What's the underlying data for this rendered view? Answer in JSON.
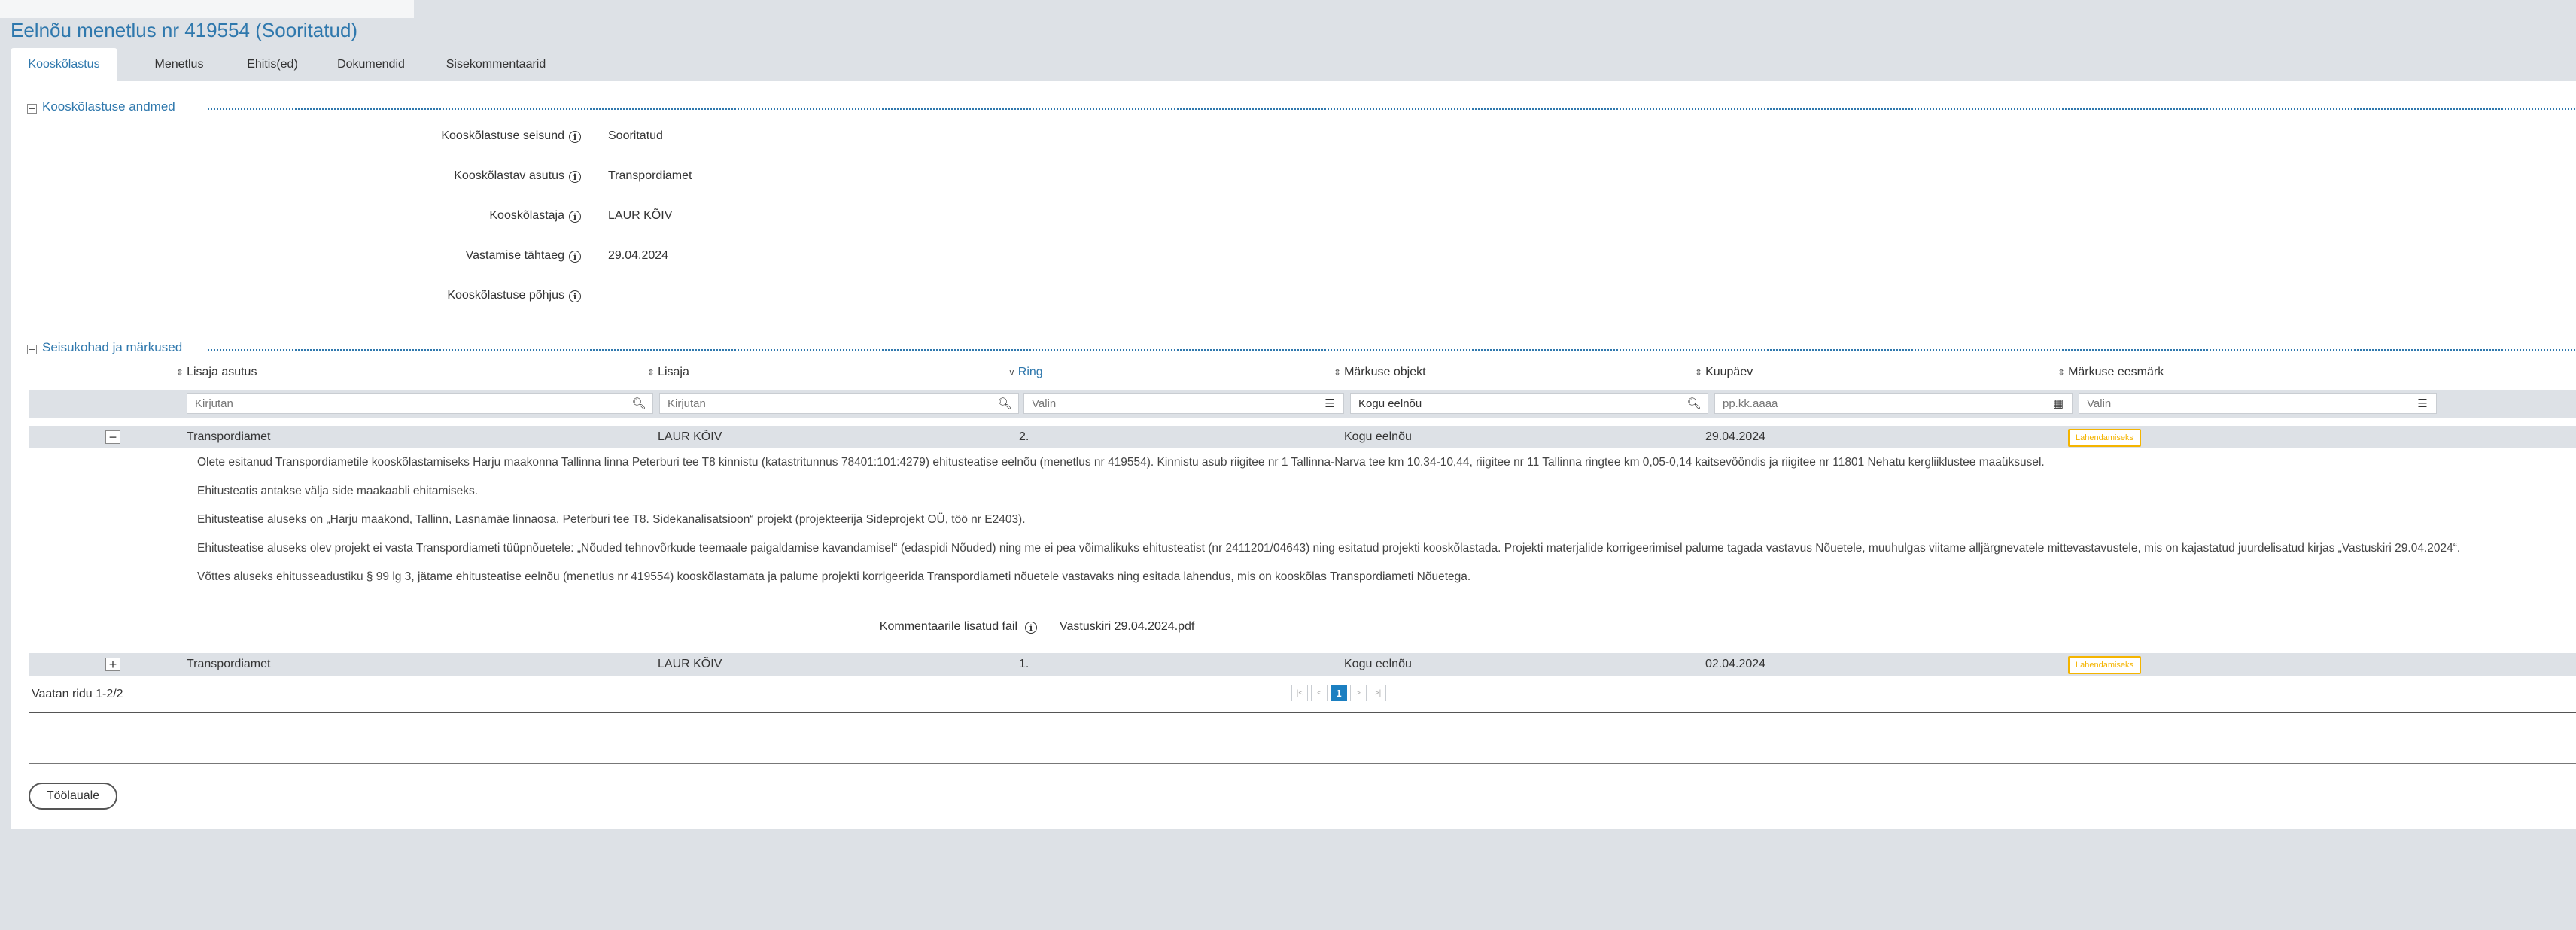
{
  "page": {
    "title": "Eelnõu menetlus nr 419554 (Sooritatud)"
  },
  "tabs": [
    {
      "label": "Kooskõlastus",
      "active": true
    },
    {
      "label": "Menetlus"
    },
    {
      "label": "Ehitis(ed)"
    },
    {
      "label": "Dokumendid"
    },
    {
      "label": "Sisekommentaarid"
    }
  ],
  "section1": {
    "title": "Kooskõlastuse andmed",
    "fields": [
      {
        "label": "Kooskõlastuse seisund",
        "value": "Sooritatud"
      },
      {
        "label": "Kooskõlastav asutus",
        "value": "Transpordiamet"
      },
      {
        "label": "Kooskõlastaja",
        "value": "LAUR KÕIV"
      },
      {
        "label": "Vastamise tähtaeg",
        "value": "29.04.2024"
      },
      {
        "label": "Kooskõlastuse põhjus",
        "value": ""
      }
    ]
  },
  "section2": {
    "title": "Seisukohad ja märkused",
    "columns": [
      {
        "label": "Lisaja asutus"
      },
      {
        "label": "Lisaja"
      },
      {
        "label": "Ring",
        "active": true
      },
      {
        "label": "Märkuse objekt"
      },
      {
        "label": "Kuupäev"
      },
      {
        "label": "Märkuse eesmärk"
      }
    ],
    "filters": {
      "asutus_placeholder": "Kirjutan",
      "lisaja_placeholder": "Kirjutan",
      "ring_placeholder": "Valin",
      "objekt_value": "Kogu eelnõu",
      "kuupaev_placeholder": "pp.kk.aaaa",
      "eesmark_placeholder": "Valin"
    },
    "rows": [
      {
        "expander": "−",
        "asutus": "Transpordiamet",
        "lisaja": "LAUR KÕIV",
        "ring": "2.",
        "objekt": "Kogu eelnõu",
        "kuupaev": "29.04.2024",
        "eesmark": "Lahendamiseks"
      },
      {
        "expander": "+",
        "asutus": "Transpordiamet",
        "lisaja": "LAUR KÕIV",
        "ring": "1.",
        "objekt": "Kogu eelnõu",
        "kuupaev": "02.04.2024",
        "eesmark": "Lahendamiseks"
      }
    ],
    "comment": [
      "Olete esitanud Transpordiametile kooskõlastamiseks Harju maakonna Tallinna linna Peterburi tee T8 kinnistu (katastritunnus 78401:101:4279) ehitusteatise eelnõu (menetlus nr 419554). Kinnistu asub riigitee nr 1 Tallinna-Narva tee km 10,34-10,44, riigitee nr 11 Tallinna ringtee km 0,05-0,14 kaitsevööndis ja riigitee nr 11801 Nehatu kergliiklustee maaüksusel.",
      "Ehitusteatis antakse välja side maakaabli ehitamiseks.",
      "Ehitusteatise aluseks on „Harju maakond, Tallinn, Lasnamäe linnaosa, Peterburi tee T8. Sidekanalisatsioon“ projekt (projekteerija Sideprojekt OÜ, töö nr E2403).",
      "Ehitusteatise aluseks olev projekt ei vasta Transpordiameti tüüpnõuetele: „Nõuded tehnovõrkude teemaale paigaldamise kavandamisel“ (edaspidi Nõuded) ning me ei pea võimalikuks ehitusteatist (nr 2411201/04643) ning esitatud projekti kooskõlastada. Projekti materjalide korrigeerimisel palume tagada vastavus Nõuetele, muuhulgas viitame alljärgnevatele mittevastavustele, mis on kajastatud juurdelisatud kirjas „Vastuskiri 29.04.2024“.",
      "Võttes aluseks ehitusseadustiku § 99 lg 3, jätame ehitusteatise eelnõu (menetlus nr 419554) kooskõlastamata ja palume projekti korrigeerida Transpordiameti nõuetele vastavaks ning esitada lahendus, mis on kooskõlas Transpordiameti Nõuetega."
    ],
    "attachment_label": "Kommentaarile lisatud fail",
    "attachment_file": "Vastuskiri 29.04.2024.pdf"
  },
  "pager": {
    "status": "Vaatan ridu 1-2/2",
    "current_page": "1",
    "first": "|<",
    "prev": "<",
    "next": ">",
    "last": ">|"
  },
  "footer": {
    "back_button": "Töölauale"
  },
  "colors": {
    "accent": "#2f78ad",
    "badge": "#f4b400",
    "page_bg": "#dde1e6",
    "pager_active": "#1b7fc1"
  }
}
